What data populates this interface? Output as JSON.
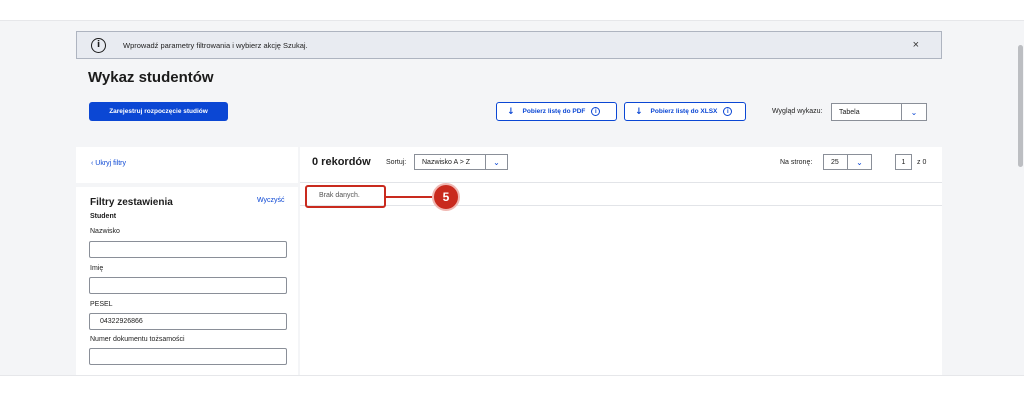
{
  "info": {
    "text": "Wprowadź parametry filtrowania i wybierz akcję Szukaj.",
    "icon": "i",
    "close": "×"
  },
  "page": {
    "title": "Wykaz studentów"
  },
  "toolbar": {
    "register_label": "Zarejestruj rozpoczęcie studiów",
    "pdf_label": "Pobierz listę do PDF",
    "xlsx_label": "Pobierz listę do XLSX",
    "download_arrow": "↓",
    "info_glyph": "i",
    "view_label": "Wygląd wykazu:",
    "view_value": "Tabela"
  },
  "filters": {
    "hide_label": "‹ Ukryj filtry",
    "title": "Filtry zestawienia",
    "clear_label": "Wyczyść",
    "section": "Student",
    "fields": [
      {
        "label": "Nazwisko",
        "value": ""
      },
      {
        "label": "Imię",
        "value": ""
      },
      {
        "label": "PESEL",
        "value": "04322926866"
      },
      {
        "label": "Numer dokumentu tożsamości",
        "value": ""
      }
    ]
  },
  "results": {
    "count_label": "0 rekordów",
    "sort_label": "Sortuj:",
    "sort_value": "Nazwisko A > Z",
    "per_page_label": "Na stronę:",
    "per_page_value": "25",
    "page_value": "1",
    "page_total": "z 0",
    "no_data": "Brak danych."
  },
  "callout": {
    "number": "5"
  },
  "colors": {
    "accent": "#0b47d4",
    "callout": "#c92a1e",
    "info_bg": "#e8ebf1"
  }
}
